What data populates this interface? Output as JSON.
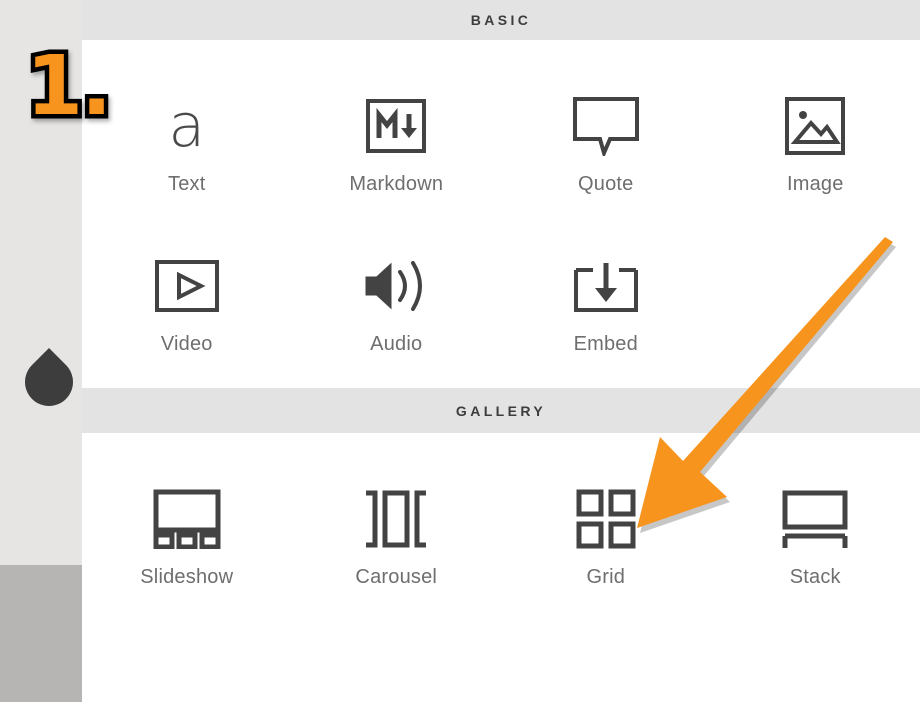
{
  "sections": [
    {
      "id": "basic",
      "title": "BASIC",
      "rows": [
        [
          {
            "label": "Text",
            "icon": "text-letter-a-icon"
          },
          {
            "label": "Markdown",
            "icon": "markdown-icon"
          },
          {
            "label": "Quote",
            "icon": "quote-bubble-icon"
          },
          {
            "label": "Image",
            "icon": "image-picture-icon"
          }
        ],
        [
          {
            "label": "Video",
            "icon": "video-play-icon"
          },
          {
            "label": "Audio",
            "icon": "audio-speaker-icon"
          },
          {
            "label": "Embed",
            "icon": "embed-download-icon"
          },
          {
            "label": "",
            "icon": ""
          }
        ]
      ]
    },
    {
      "id": "gallery",
      "title": "GALLERY",
      "rows": [
        [
          {
            "label": "Slideshow",
            "icon": "slideshow-icon"
          },
          {
            "label": "Carousel",
            "icon": "carousel-icon"
          },
          {
            "label": "Grid",
            "icon": "grid-icon"
          },
          {
            "label": "Stack",
            "icon": "stack-icon"
          }
        ]
      ]
    }
  ],
  "annotation": {
    "step_number": "1.",
    "arrow": "orange-arrow-pointing-to-grid",
    "accent_color": "#f7941e"
  },
  "colors": {
    "panel_background": "#ffffff",
    "section_header_background": "#e3e3e3",
    "section_header_text": "#3d3d3d",
    "icon_stroke": "#434343",
    "label_text": "#6e6e6e",
    "left_strip_upper": "#e6e5e3",
    "left_strip_lower": "#b6b5b3",
    "pin_marker": "#3d3d3d",
    "accent_orange": "#f7941e"
  }
}
